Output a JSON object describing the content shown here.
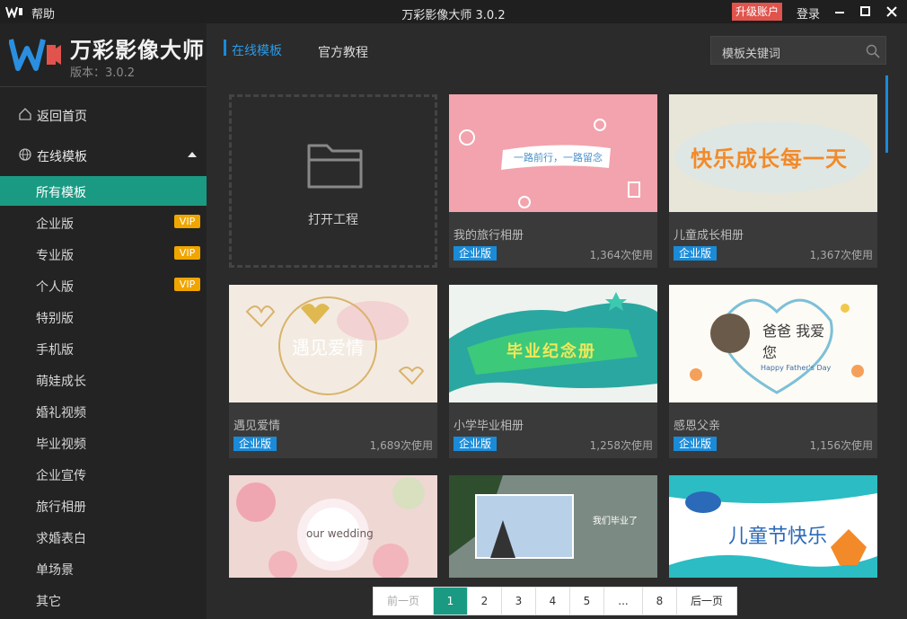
{
  "titlebar": {
    "help": "帮助",
    "title": "万彩影像大师 3.0.2",
    "upgrade": "升级账户",
    "login": "登录"
  },
  "brand": {
    "name": "万彩影像大师",
    "version": "版本：3.0.2"
  },
  "nav": {
    "home": "返回首页",
    "online": "在线模板",
    "items": [
      {
        "label": "所有模板",
        "vip": ""
      },
      {
        "label": "企业版",
        "vip": "VIP"
      },
      {
        "label": "专业版",
        "vip": "VIP"
      },
      {
        "label": "个人版",
        "vip": "VIP"
      },
      {
        "label": "特别版",
        "vip": ""
      },
      {
        "label": "手机版",
        "vip": ""
      },
      {
        "label": "萌娃成长",
        "vip": ""
      },
      {
        "label": "婚礼视频",
        "vip": ""
      },
      {
        "label": "毕业视频",
        "vip": ""
      },
      {
        "label": "企业宣传",
        "vip": ""
      },
      {
        "label": "旅行相册",
        "vip": ""
      },
      {
        "label": "求婚表白",
        "vip": ""
      },
      {
        "label": "单场景",
        "vip": ""
      },
      {
        "label": "其它",
        "vip": ""
      }
    ]
  },
  "tabs": {
    "online": "在线模板",
    "tutorial": "官方教程"
  },
  "search": {
    "placeholder": "模板关键词"
  },
  "open_project": "打开工程",
  "cards": [
    {
      "name": "我的旅行相册",
      "badge": "企业版",
      "usage": "1,364次使用",
      "thumb_text": "一路前行，一路留念"
    },
    {
      "name": "儿童成长相册",
      "badge": "企业版",
      "usage": "1,367次使用",
      "thumb_text": "快乐成长每一天"
    },
    {
      "name": "遇见爱情",
      "badge": "企业版",
      "usage": "1,689次使用",
      "thumb_text": "遇见爱情"
    },
    {
      "name": "小学毕业相册",
      "badge": "企业版",
      "usage": "1,258次使用",
      "thumb_text": "毕业纪念册"
    },
    {
      "name": "感恩父亲",
      "badge": "企业版",
      "usage": "1,156次使用",
      "thumb_text": "爸爸 我爱您",
      "thumb_sub": "Happy Father's Day"
    },
    {
      "name": "",
      "badge": "",
      "usage": "",
      "thumb_text": "our wedding"
    },
    {
      "name": "",
      "badge": "",
      "usage": "",
      "thumb_text": "我们毕业了"
    },
    {
      "name": "",
      "badge": "",
      "usage": "",
      "thumb_text": "儿童节快乐"
    }
  ],
  "pager": {
    "prev": "前一页",
    "pages": [
      "1",
      "2",
      "3",
      "4",
      "5",
      "...",
      "8"
    ],
    "next": "后一页",
    "current": "1"
  },
  "colors": {
    "accent_teal": "#1a9a83",
    "accent_blue": "#1a8bd8",
    "vip": "#f0a500",
    "upgrade": "#e0544d"
  }
}
